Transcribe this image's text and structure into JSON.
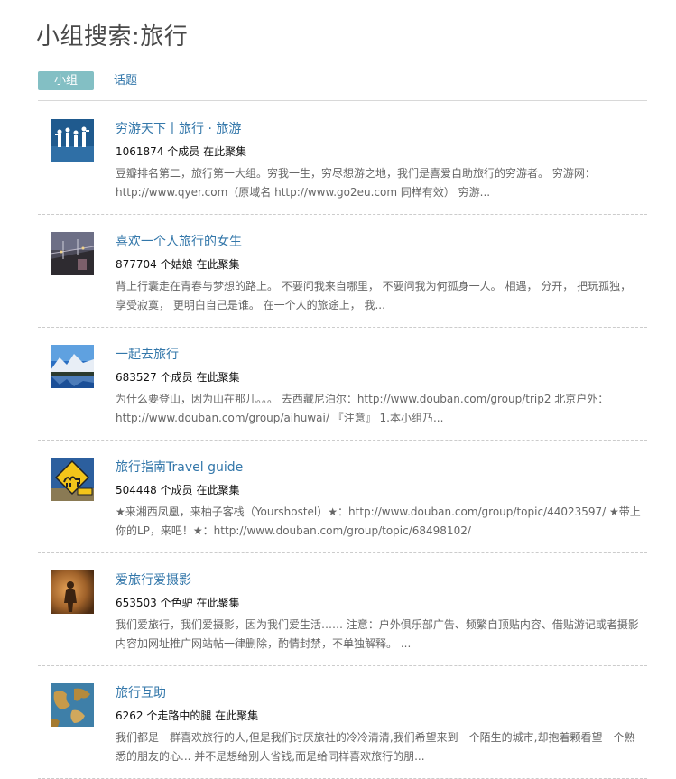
{
  "page_title": "小组搜索:旅行",
  "tabs": [
    {
      "label": "小组",
      "active": true
    },
    {
      "label": "话题",
      "active": false
    }
  ],
  "colors": {
    "accent_tab": "#83bfc4",
    "link": "#3377aa",
    "desc": "#666666"
  },
  "results": [
    {
      "name": "穷游天下丨旅行 · 旅游",
      "meta": "1061874 个成员 在此聚集",
      "desc": "豆瓣排名第二，旅行第一大组。穷我一生，穷尽想游之地，我们是喜爱自助旅行的穷游者。 穷游网：http://www.qyer.com（原域名 http://www.go2eu.com 同样有效） 穷游...",
      "icon": "silhouette-travelers-icon"
    },
    {
      "name": "喜欢一个人旅行的女生",
      "meta": "877704 个姑娘 在此聚集",
      "desc": "背上行囊走在青春与梦想的路上。 不要问我来自哪里， 不要问我为何孤身一人。 相遇， 分开， 把玩孤独， 享受寂寞， 更明白自己是谁。 在一个人的旅途上， 我...",
      "icon": "night-bridge-icon"
    },
    {
      "name": "一起去旅行",
      "meta": "683527 个成员 在此聚集",
      "desc": "为什么要登山，因为山在那儿。。。 去西藏尼泊尔：http://www.douban.com/group/trip2 北京户外：http://www.douban.com/group/aihuwai/ 『注意』 1.本小组乃...",
      "icon": "mountain-lake-icon"
    },
    {
      "name": "旅行指南Travel guide",
      "meta": "504448 个成员 在此聚集",
      "desc": "★来湘西凤凰，来柚子客栈（Yourshostel）★：http://www.douban.com/group/topic/44023597/ ★带上你的LP，来吧！★：http://www.douban.com/group/topic/68498102/",
      "icon": "camel-road-sign-icon"
    },
    {
      "name": "爱旅行爱摄影",
      "meta": "653503 个色驴 在此聚集",
      "desc": "我们爱旅行，我们爱摄影，因为我们爱生活…… 注意：户外俱乐部广告、频繁自顶贴内容、借贴游记或者摄影内容加网址推广网站帖一律删除，酌情封禁，不单独解释。 ...",
      "icon": "shadow-photographer-icon"
    },
    {
      "name": "旅行互助",
      "meta": "6262 个走路中的腿 在此聚集",
      "desc": "我们都是一群喜欢旅行的人,但是我们讨厌旅社的冷冷清清,我们希望来到一个陌生的城市,却抱着颗看望一个熟悉的朋友的心... 并不是想给别人省钱,而是给同样喜欢旅行的朋...",
      "icon": "world-map-icon"
    }
  ]
}
